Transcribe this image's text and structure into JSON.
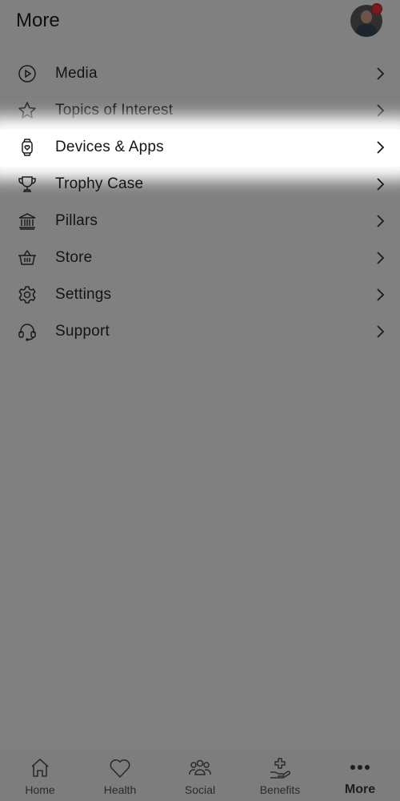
{
  "header": {
    "title": "More"
  },
  "menu": {
    "items": [
      {
        "label": "Media",
        "icon": "play-circle-icon"
      },
      {
        "label": "Topics of Interest",
        "icon": "star-icon"
      },
      {
        "label": "Devices & Apps",
        "icon": "smartwatch-icon"
      },
      {
        "label": "Trophy Case",
        "icon": "trophy-icon"
      },
      {
        "label": "Pillars",
        "icon": "bank-icon"
      },
      {
        "label": "Store",
        "icon": "basket-icon"
      },
      {
        "label": "Settings",
        "icon": "gear-icon"
      },
      {
        "label": "Support",
        "icon": "headset-icon"
      }
    ]
  },
  "bottom_nav": {
    "items": [
      {
        "label": "Home",
        "icon": "home-icon"
      },
      {
        "label": "Health",
        "icon": "heart-icon"
      },
      {
        "label": "Social",
        "icon": "people-icon"
      },
      {
        "label": "Benefits",
        "icon": "hand-plus-icon"
      },
      {
        "label": "More",
        "icon": "more-dots-icon",
        "active": true
      }
    ]
  },
  "colors": {
    "overlay": "#808080",
    "highlight": "#ffffff",
    "notification_badge": "#7a1a1a"
  }
}
